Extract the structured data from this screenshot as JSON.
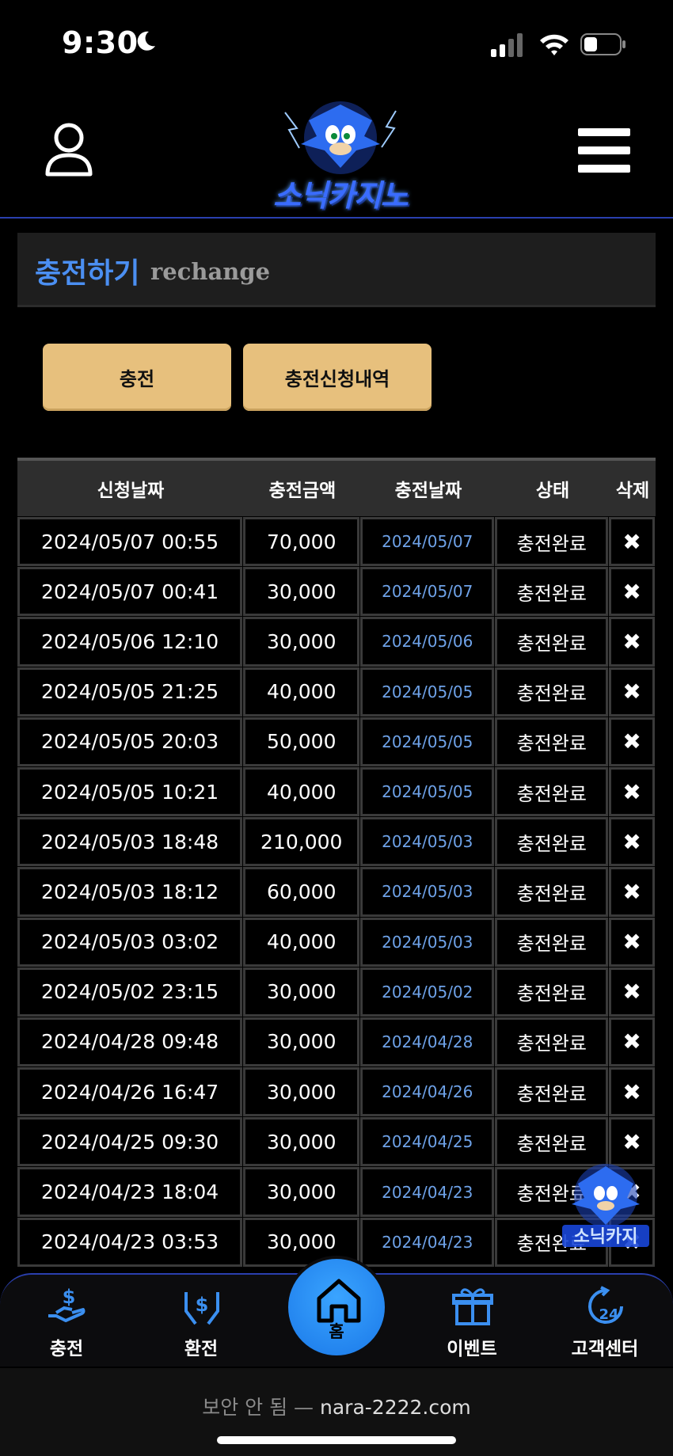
{
  "status_bar": {
    "time": "9:30"
  },
  "header": {
    "logo_text": "소닉카지노"
  },
  "section": {
    "title_ko": "충전하기",
    "title_en": "rechange"
  },
  "buttons": {
    "charge": "충전",
    "history": "충전신청내역"
  },
  "table": {
    "headers": [
      "신청날짜",
      "충전금액",
      "충전날짜",
      "상태",
      "삭제"
    ],
    "rows": [
      {
        "requested": "2024/05/07 00:55",
        "amount": "70,000",
        "charged": "2024/05/07",
        "status": "충전완료",
        "delete": "✖"
      },
      {
        "requested": "2024/05/07 00:41",
        "amount": "30,000",
        "charged": "2024/05/07",
        "status": "충전완료",
        "delete": "✖"
      },
      {
        "requested": "2024/05/06 12:10",
        "amount": "30,000",
        "charged": "2024/05/06",
        "status": "충전완료",
        "delete": "✖"
      },
      {
        "requested": "2024/05/05 21:25",
        "amount": "40,000",
        "charged": "2024/05/05",
        "status": "충전완료",
        "delete": "✖"
      },
      {
        "requested": "2024/05/05 20:03",
        "amount": "50,000",
        "charged": "2024/05/05",
        "status": "충전완료",
        "delete": "✖"
      },
      {
        "requested": "2024/05/05 10:21",
        "amount": "40,000",
        "charged": "2024/05/05",
        "status": "충전완료",
        "delete": "✖"
      },
      {
        "requested": "2024/05/03 18:48",
        "amount": "210,000",
        "charged": "2024/05/03",
        "status": "충전완료",
        "delete": "✖"
      },
      {
        "requested": "2024/05/03 18:12",
        "amount": "60,000",
        "charged": "2024/05/03",
        "status": "충전완료",
        "delete": "✖"
      },
      {
        "requested": "2024/05/03 03:02",
        "amount": "40,000",
        "charged": "2024/05/03",
        "status": "충전완료",
        "delete": "✖"
      },
      {
        "requested": "2024/05/02 23:15",
        "amount": "30,000",
        "charged": "2024/05/02",
        "status": "충전완료",
        "delete": "✖"
      },
      {
        "requested": "2024/04/28 09:48",
        "amount": "30,000",
        "charged": "2024/04/28",
        "status": "충전완료",
        "delete": "✖"
      },
      {
        "requested": "2024/04/26 16:47",
        "amount": "30,000",
        "charged": "2024/04/26",
        "status": "충전완료",
        "delete": "✖"
      },
      {
        "requested": "2024/04/25 09:30",
        "amount": "30,000",
        "charged": "2024/04/25",
        "status": "충전완료",
        "delete": "✖"
      },
      {
        "requested": "2024/04/23 18:04",
        "amount": "30,000",
        "charged": "2024/04/23",
        "status": "충전완료",
        "delete": "✖"
      },
      {
        "requested": "2024/04/23 03:53",
        "amount": "30,000",
        "charged": "2024/04/23",
        "status": "충전완료",
        "delete": "✖"
      }
    ]
  },
  "nav": {
    "charge": "충전",
    "exchange": "환전",
    "home": "홈",
    "event": "이벤트",
    "support": "고객센터"
  },
  "url_bar": {
    "prefix": "보안 안 됨 —",
    "domain": "nara-2222.com"
  },
  "colors": {
    "accent": "#4b8ff2",
    "button_gold": "#e7c07d",
    "home_blue": "#2a8cf0"
  }
}
